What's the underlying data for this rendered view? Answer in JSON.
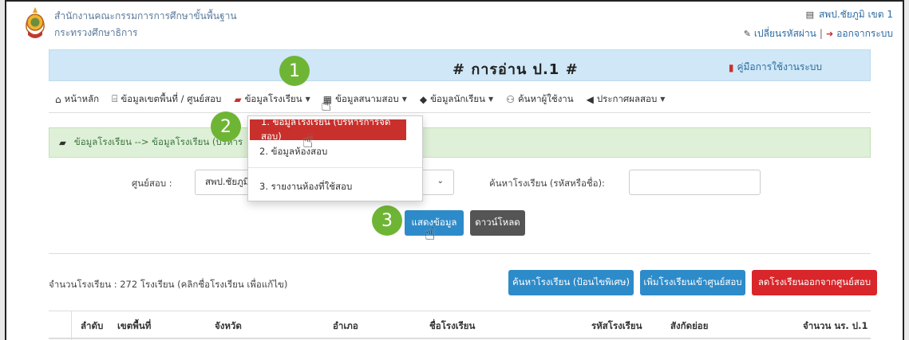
{
  "header": {
    "org_line1": "สำนักงานคณะกรรมการการศึกษาขั้นพื้นฐาน",
    "org_line2": "กระทรวงศึกษาธิการ",
    "user_label": "สพป.ชัยภูมิ เขต 1",
    "change_password": "เปลี่ยนรหัสผ่าน",
    "separator": "|",
    "logout": "ออกจากระบบ"
  },
  "banner": {
    "title": "# การอ่าน ป.1 #",
    "manual_link": "คู่มือการใช้งานระบบ"
  },
  "nav": {
    "items": [
      {
        "label": "หน้าหลัก",
        "icon": "home-icon"
      },
      {
        "label": "ข้อมูลเขตพื้นที่ / ศูนย์สอบ",
        "icon": "institution-icon"
      },
      {
        "label": "ข้อมูลโรงเรียน",
        "icon": "briefcase-icon"
      },
      {
        "label": "ข้อมูลสนามสอบ",
        "icon": "building-icon"
      },
      {
        "label": "ข้อมูลนักเรียน",
        "icon": "graduation-cap-icon"
      },
      {
        "label": "ค้นหาผู้ใช้งาน",
        "icon": "users-icon"
      },
      {
        "label": "ประกาศผลสอบ",
        "icon": "bullhorn-icon"
      }
    ]
  },
  "dropdown": {
    "items": [
      "1. ข้อมูลโรงเรียน (บริหารการจัดสอบ)",
      "2. ข้อมูลห้องสอบ",
      "3. รายงานห้องที่ใช้สอบ"
    ]
  },
  "breadcrumb": {
    "text": "ข้อมูลโรงเรียน --> ข้อมูลโรงเรียน (บริหาร"
  },
  "form": {
    "center_label": "ศูนย์สอบ :",
    "center_value": "สพป.ชัยภูมิ",
    "search_label": "ค้นหาโรงเรียน (รหัสหรือชื่อ):",
    "search_value": "",
    "show_button": "แสดงข้อมูล",
    "download_button": "ดาวน์โหลด"
  },
  "steps": [
    "1",
    "2",
    "3"
  ],
  "summary": {
    "count_text": "จำนวนโรงเรียน : 272 โรงเรียน (คลิกชื่อโรงเรียน เพื่อแก้ไข)"
  },
  "actions": {
    "search_school": "ค้นหาโรงเรียน (ป้อนไขพิเศษ)",
    "add_school": "เพิ่มโรงเรียนเข้าศูนย์สอบ",
    "remove_school": "ลดโรงเรียนออกจากศูนย์สอบ"
  },
  "table": {
    "columns": [
      "ลำดับ",
      "เขตพื้นที่",
      "จังหวัด",
      "อำเภอ",
      "ชื่อโรงเรียน",
      "รหัสโรงเรียน",
      "สังกัดย่อย",
      "จำนวน นร. ป.1"
    ]
  },
  "colors": {
    "step_green": "#6fb535",
    "banner_blue": "#cfe7f6",
    "active_red": "#c9302c",
    "button_blue": "#2e8bc9",
    "button_red": "#d9262a"
  }
}
